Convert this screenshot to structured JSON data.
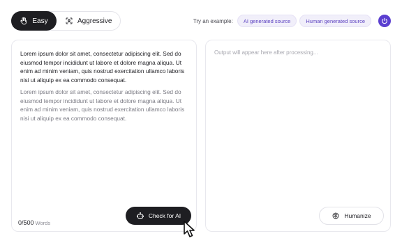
{
  "mode_toggle": {
    "easy_label": "Easy",
    "aggressive_label": "Aggressive",
    "selected": "Easy"
  },
  "examples": {
    "label": "Try an example:",
    "chips": [
      "AI generated source",
      "Human generated source"
    ]
  },
  "input": {
    "paragraphs": [
      "Lorem ipsum dolor sit amet, consectetur adipiscing elit. Sed do eiusmod tempor incididunt ut labore et dolore magna aliqua. Ut enim ad minim veniam, quis nostrud exercitation ullamco laboris nisi ut aliquip ex ea commodo consequat.",
      "Lorem ipsum dolor sit amet, consectetur adipiscing elit. Sed do eiusmod tempor incididunt ut labore et dolore magna aliqua. Ut enim ad minim veniam, quis nostrud exercitation ullamco laboris nisi ut aliquip ex ea commodo consequat."
    ],
    "word_count": "0/500",
    "word_count_label": "Words",
    "check_button_label": "Check for AI"
  },
  "output": {
    "placeholder": "Output will appear here after processing...",
    "humanize_button_label": "Humanize"
  },
  "icons": {
    "easy": "hand-icon",
    "aggressive": "scan-icon",
    "help": "power-icon",
    "check": "robot-icon",
    "humanize": "brain-icon",
    "cursor": "pointer-cursor-icon"
  },
  "colors": {
    "dark": "#1e1e22",
    "accent": "#5b3fd0",
    "chip_bg": "#f1effa",
    "chip_text": "#5a3fc0"
  }
}
